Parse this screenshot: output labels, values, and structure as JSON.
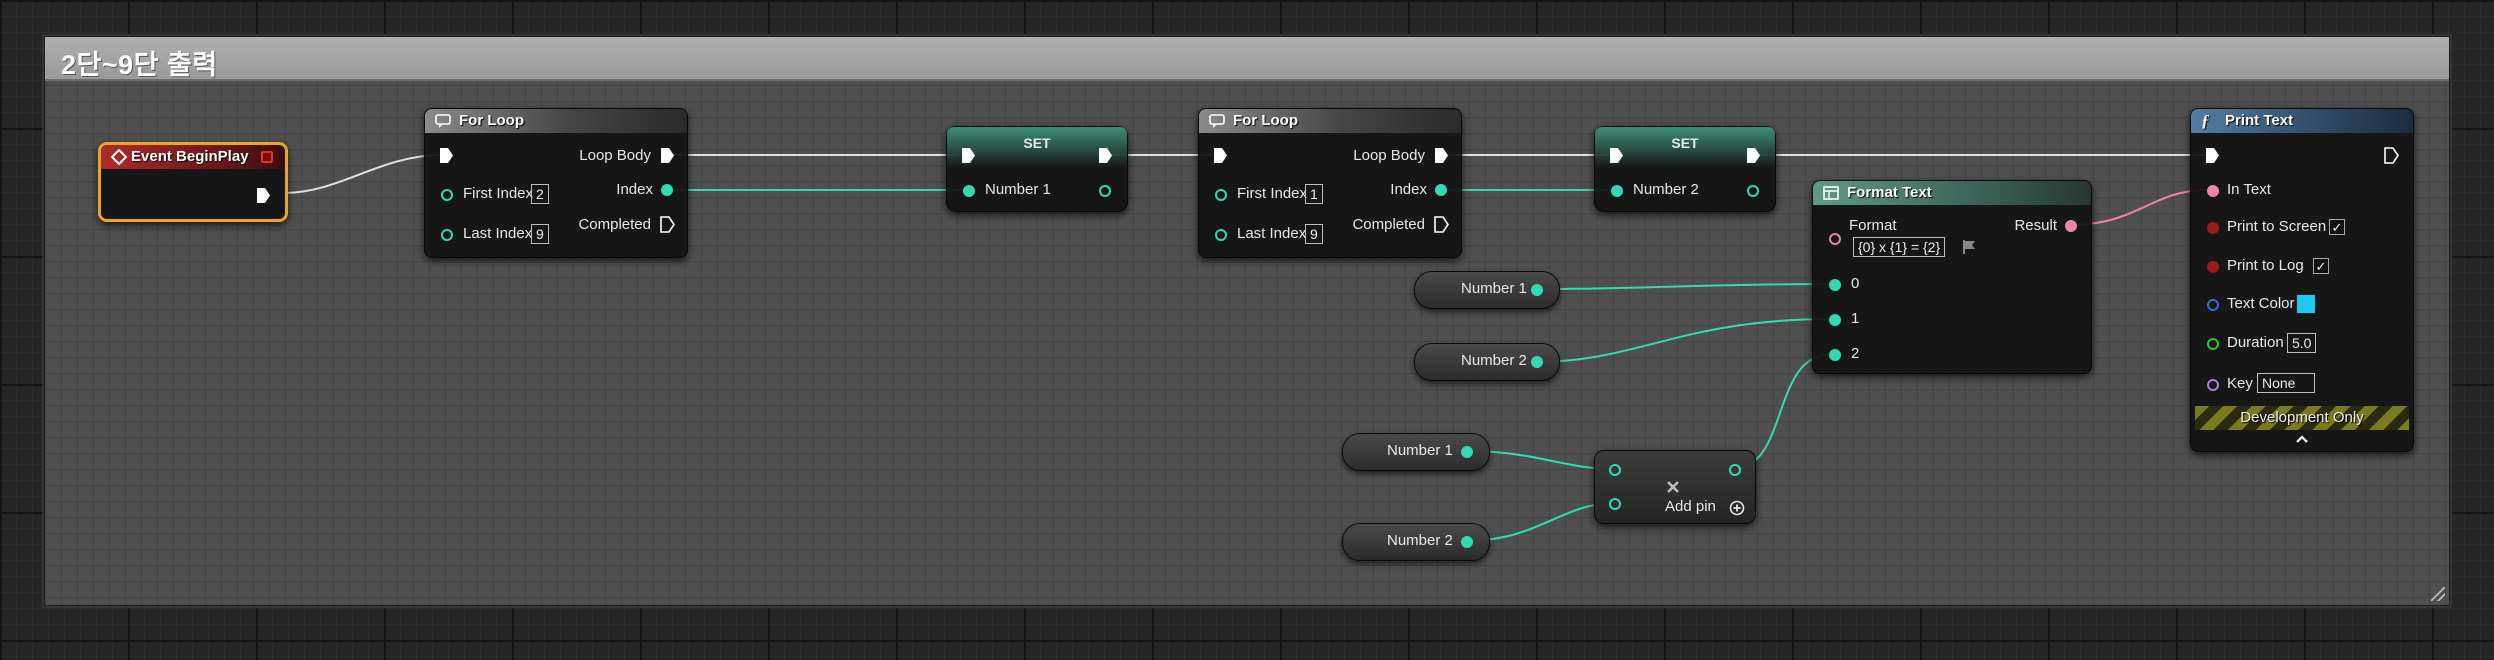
{
  "comment": {
    "title": "2단~9단 출력"
  },
  "event_begin_play": {
    "title": "Event BeginPlay"
  },
  "for_loop_1": {
    "title": "For Loop",
    "loop_body": "Loop Body",
    "first_index_label": "First Index",
    "first_index_value": "2",
    "last_index_label": "Last Index",
    "last_index_value": "9",
    "index": "Index",
    "completed": "Completed"
  },
  "set_1": {
    "title": "SET",
    "var": "Number 1"
  },
  "for_loop_2": {
    "title": "For Loop",
    "loop_body": "Loop Body",
    "first_index_label": "First Index",
    "first_index_value": "1",
    "last_index_label": "Last Index",
    "last_index_value": "9",
    "index": "Index",
    "completed": "Completed"
  },
  "set_2": {
    "title": "SET",
    "var": "Number 2"
  },
  "format_text": {
    "title": "Format Text",
    "format_label": "Format",
    "format_value": "{0} x {1} = {2}",
    "result": "Result",
    "pin0": "0",
    "pin1": "1",
    "pin2": "2"
  },
  "get_nodes": {
    "number1_a": "Number 1",
    "number2_a": "Number 2",
    "number1_b": "Number 1",
    "number2_b": "Number 2"
  },
  "multiply": {
    "add_pin": "Add pin"
  },
  "print_text": {
    "title": "Print Text",
    "in_text": "In Text",
    "print_to_screen": "Print to Screen",
    "print_to_log": "Print to Log",
    "text_color": "Text Color",
    "text_color_value": "#1ec8f0",
    "duration_label": "Duration",
    "duration_value": "5.0",
    "key_label": "Key",
    "key_value": "None",
    "dev_only": "Development Only"
  }
}
